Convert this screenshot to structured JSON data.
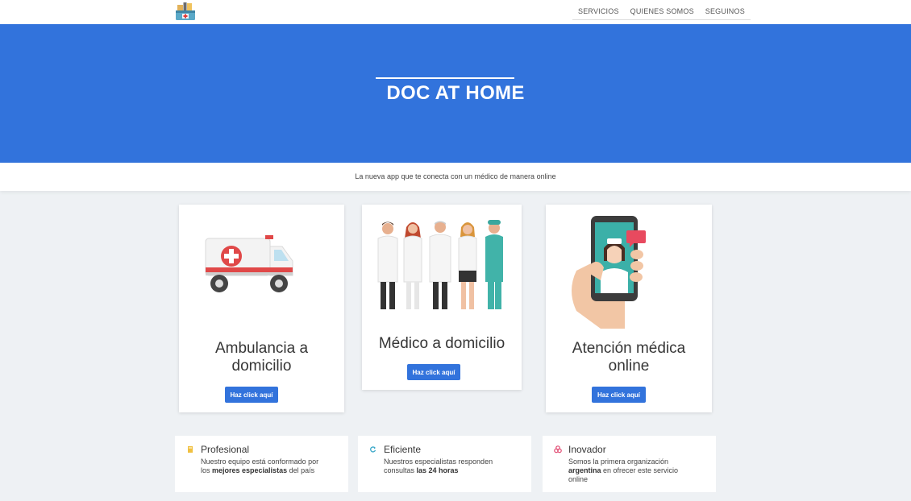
{
  "nav": {
    "items": [
      "SERVICIOS",
      "QUIENES SOMOS",
      "SEGUINOS"
    ]
  },
  "hero": {
    "title": "DOC AT HOME"
  },
  "subtitle": "La nueva app que te conecta con un médico de manera online",
  "cards": [
    {
      "title_line1": "Ambulancia a",
      "title_line2": "domicilio",
      "button": "Haz click aquí",
      "image": "ambulance-illustration"
    },
    {
      "title_line1": "Médico a domicilio",
      "button": "Haz click aquí",
      "image": "doctors-group-illustration"
    },
    {
      "title_line1": "Atención médica",
      "title_line2": "online",
      "button": "Haz click aquí",
      "image": "phone-doctor-illustration"
    }
  ],
  "features": [
    {
      "title": "Profesional",
      "icon": "book-icon",
      "desc_pre": "Nuestro equipo está conformado por los ",
      "desc_bold": "mejores especialistas",
      "desc_post": " del país"
    },
    {
      "title": "Eficiente",
      "icon": "refresh-icon",
      "desc_pre": "Nuestros especialistas responden consultas ",
      "desc_bold": "las 24 horas",
      "desc_post": ""
    },
    {
      "title": "Inovador",
      "icon": "flower-icon",
      "desc_pre": "Somos la primera organización ",
      "desc_bold": "argentina",
      "desc_post": " en ofrecer este servicio online"
    }
  ],
  "colors": {
    "primary": "#3273dc",
    "background": "#eef1f4"
  }
}
